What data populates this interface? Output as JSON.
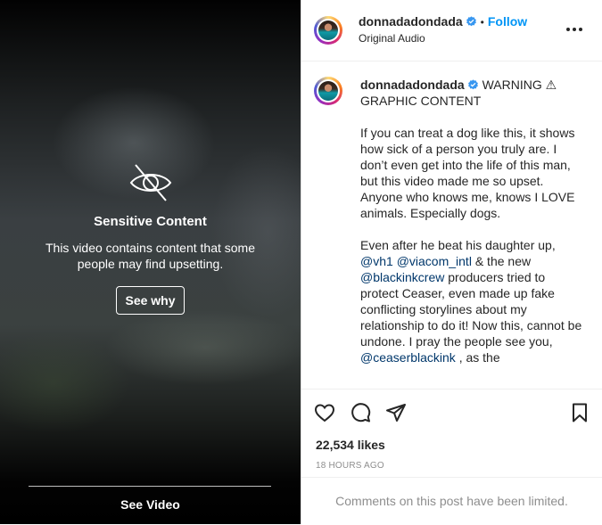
{
  "media": {
    "sensitive_title": "Sensitive Content",
    "sensitive_text": "This video contains content that some people may find upsetting.",
    "see_why_label": "See why",
    "see_video_label": "See Video"
  },
  "header": {
    "username": "donnadadondada",
    "separator": "•",
    "follow_label": "Follow",
    "audio_label": "Original Audio"
  },
  "caption": {
    "username": "donnadadondada",
    "headline": "WARNING ⚠ GRAPHIC CONTENT",
    "paragraph1": "If you can treat a dog like this, it shows how sick of a person you truly are. I don’t even get into the life of this man, but this video made me so upset. Anyone who knows me, knows I LOVE animals. Especially dogs.",
    "paragraph2_before": "Even after he beat his daughter up,",
    "mention_vh1": "@vh1",
    "mention_viacom": "@viacom_intl",
    "paragraph2_mid1": "& the new",
    "mention_blackinkcrew": "@blackinkcrew",
    "paragraph2_mid2": "producers tried to protect Ceaser, even made up fake conflicting storylines about my relationship to do it! Now this, cannot be undone. I pray the people see you,",
    "mention_ceaser": "@ceaserblackink",
    "paragraph2_after": ", as the"
  },
  "footer": {
    "likes": "22,534 likes",
    "timestamp": "18 HOURS AGO",
    "comments_limited": "Comments on this post have been limited."
  },
  "colors": {
    "accent": "#0095f6",
    "mention": "#00376b",
    "verified": "#3897f0",
    "muted": "#8e8e8e"
  },
  "icons": [
    "eye-off-icon",
    "verified-badge-icon",
    "more-options-icon",
    "heart-icon",
    "comment-icon",
    "share-icon",
    "bookmark-icon"
  ]
}
